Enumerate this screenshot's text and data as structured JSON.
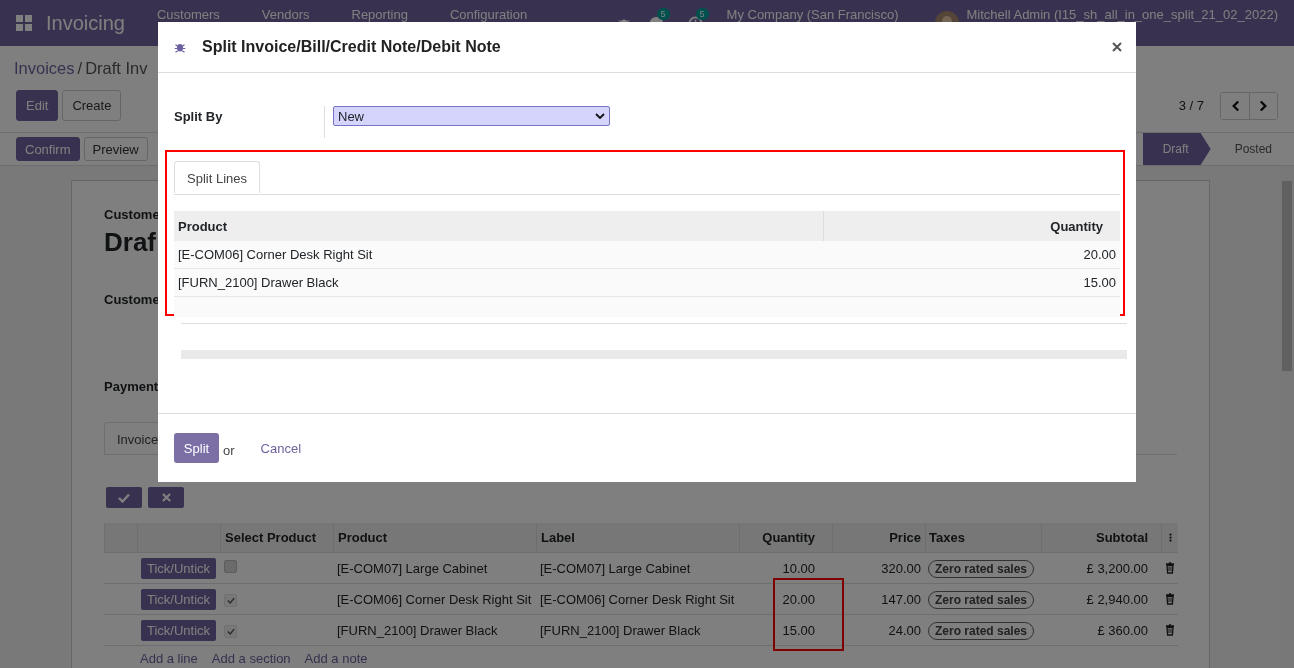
{
  "navbar": {
    "app_name": "Invoicing",
    "menu": [
      "Customers",
      "Vendors",
      "Reporting",
      "Configuration"
    ],
    "chat_badge": "5",
    "activity_badge": "5",
    "company": "My Company (San Francisco)",
    "user": "Mitchell Admin (I15_sh_all_in_one_split_21_02_2022)"
  },
  "breadcrumb": {
    "parent": "Invoices",
    "separator": "/",
    "current": "Draft Inv"
  },
  "buttons": [
    "Edit",
    "Create"
  ],
  "pager": "3 / 7",
  "status_buttons": [
    "Confirm",
    "Preview"
  ],
  "stages": [
    {
      "label": "Draft",
      "selected": true
    },
    {
      "label": "Posted",
      "selected": false
    }
  ],
  "sheet": {
    "type_label": "Custome",
    "title": "Draf",
    "customer_label": "Custome",
    "payment_label": "Payment",
    "tabs": [
      {
        "label": "Invoice",
        "selected": true
      }
    ]
  },
  "lines": {
    "columns": [
      "Select Product",
      "Product",
      "Label",
      "Quantity",
      "Price",
      "Taxes",
      "Subtotal"
    ],
    "rows": [
      {
        "button": "Tick/Untick",
        "checked": false,
        "product": "[E-COM07] Large Cabinet",
        "label": "[E-COM07] Large Cabinet",
        "quantity": "10.00",
        "price": "320.00",
        "tax": "Zero rated sales",
        "subtotal": "£ 3,200.00"
      },
      {
        "button": "Tick/Untick",
        "checked": true,
        "product": "[E-COM06] Corner Desk Right Sit",
        "label": "[E-COM06] Corner Desk Right Sit",
        "quantity": "20.00",
        "price": "147.00",
        "tax": "Zero rated sales",
        "subtotal": "£ 2,940.00"
      },
      {
        "button": "Tick/Untick",
        "checked": true,
        "product": "[FURN_2100] Drawer Black",
        "label": "[FURN_2100] Drawer Black",
        "quantity": "15.00",
        "price": "24.00",
        "tax": "Zero rated sales",
        "subtotal": "£ 360.00"
      }
    ],
    "add_links": [
      "Add a line",
      "Add a section",
      "Add a note"
    ]
  },
  "dialog": {
    "title": "Split Invoice/Bill/Credit Note/Debit Note",
    "split_by_label": "Split By",
    "split_by_value": "New",
    "tabs": [
      {
        "label": "Split Lines",
        "selected": true
      }
    ],
    "columns": [
      "Product",
      "Quantity"
    ],
    "rows": [
      {
        "product": "[E-COM06] Corner Desk Right Sit",
        "quantity": "20.00"
      },
      {
        "product": "[FURN_2100] Drawer Black",
        "quantity": "15.00"
      }
    ],
    "primary_button": "Split",
    "or_text": "or",
    "cancel": "Cancel"
  }
}
